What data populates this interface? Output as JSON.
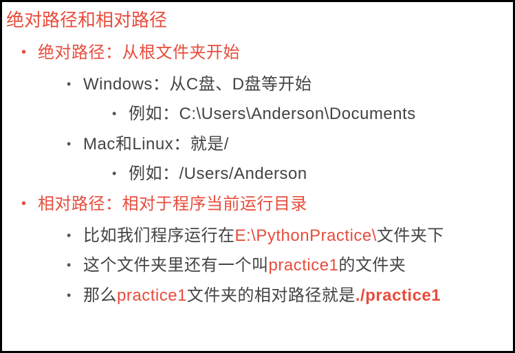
{
  "title": "绝对路径和相对路径",
  "items": [
    {
      "label": "绝对路径：从根文件夹开始",
      "red": true,
      "children": [
        {
          "label": "Windows：从C盘、D盘等开始",
          "children": [
            {
              "label": "例如：C:\\Users\\Anderson\\Documents"
            }
          ]
        },
        {
          "label": "Mac和Linux：就是/",
          "children": [
            {
              "label": "例如：/Users/Anderson"
            }
          ]
        }
      ]
    },
    {
      "label_parts": [
        {
          "t": "相对路径：相对于程序当前运行目录",
          "red": true
        }
      ],
      "children": [
        {
          "label_parts": [
            {
              "t": "比如我们程序运行在"
            },
            {
              "t": "E:\\PythonPractice\\",
              "red": true
            },
            {
              "t": "文件夹下"
            }
          ]
        },
        {
          "label_parts": [
            {
              "t": "这个文件夹里还有一个叫"
            },
            {
              "t": "practice1",
              "red": true
            },
            {
              "t": "的文件夹"
            }
          ]
        },
        {
          "label_parts": [
            {
              "t": "那么"
            },
            {
              "t": "practice1",
              "red": true
            },
            {
              "t": "文件夹的相对路径就是"
            },
            {
              "t": "./practice1",
              "red": true,
              "bold": true
            }
          ]
        }
      ]
    }
  ]
}
